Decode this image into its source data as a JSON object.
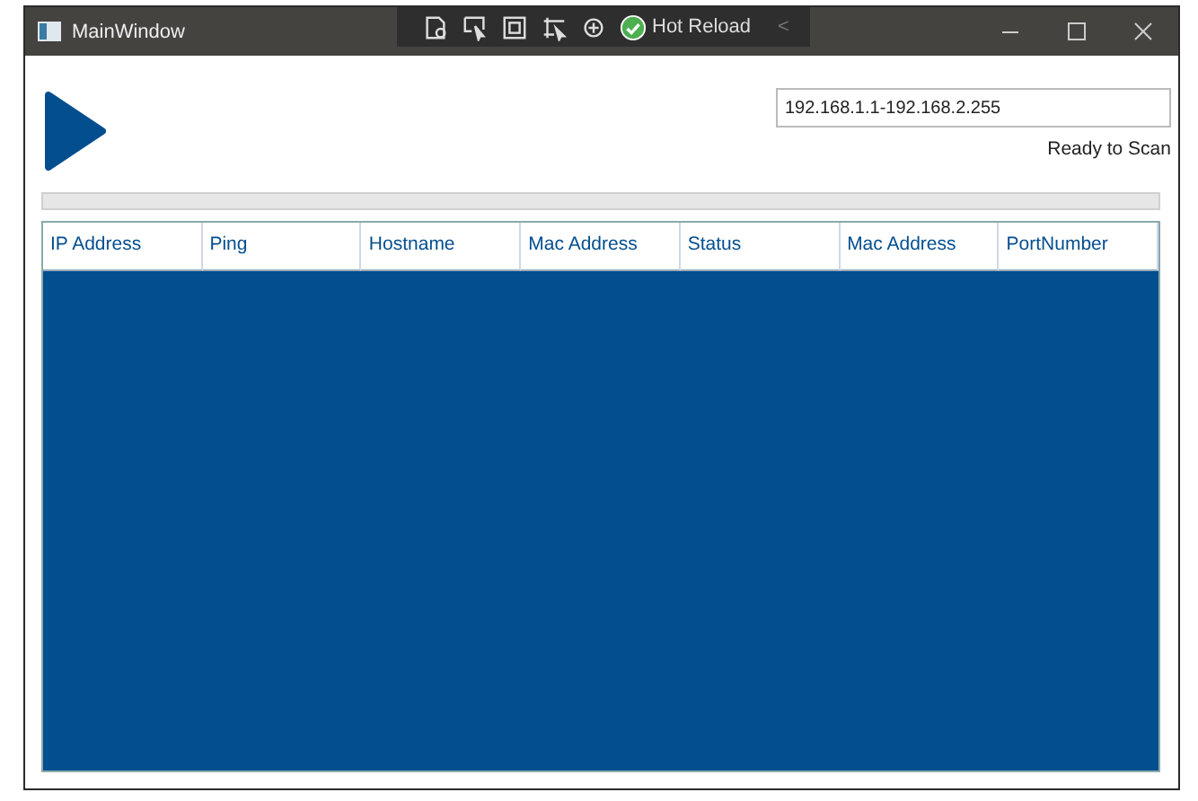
{
  "window": {
    "title": "MainWindow"
  },
  "debug_toolbar": {
    "label": "Hot Reload",
    "collapse": "<"
  },
  "range": {
    "value": "192.168.1.1-192.168.2.255"
  },
  "status": "Ready to Scan",
  "progress": {
    "level": 0
  },
  "table": {
    "columns": [
      "IP Address",
      "Ping",
      "Hostname",
      "Mac Address",
      "Status",
      "Mac Address",
      "PortNumber"
    ]
  }
}
